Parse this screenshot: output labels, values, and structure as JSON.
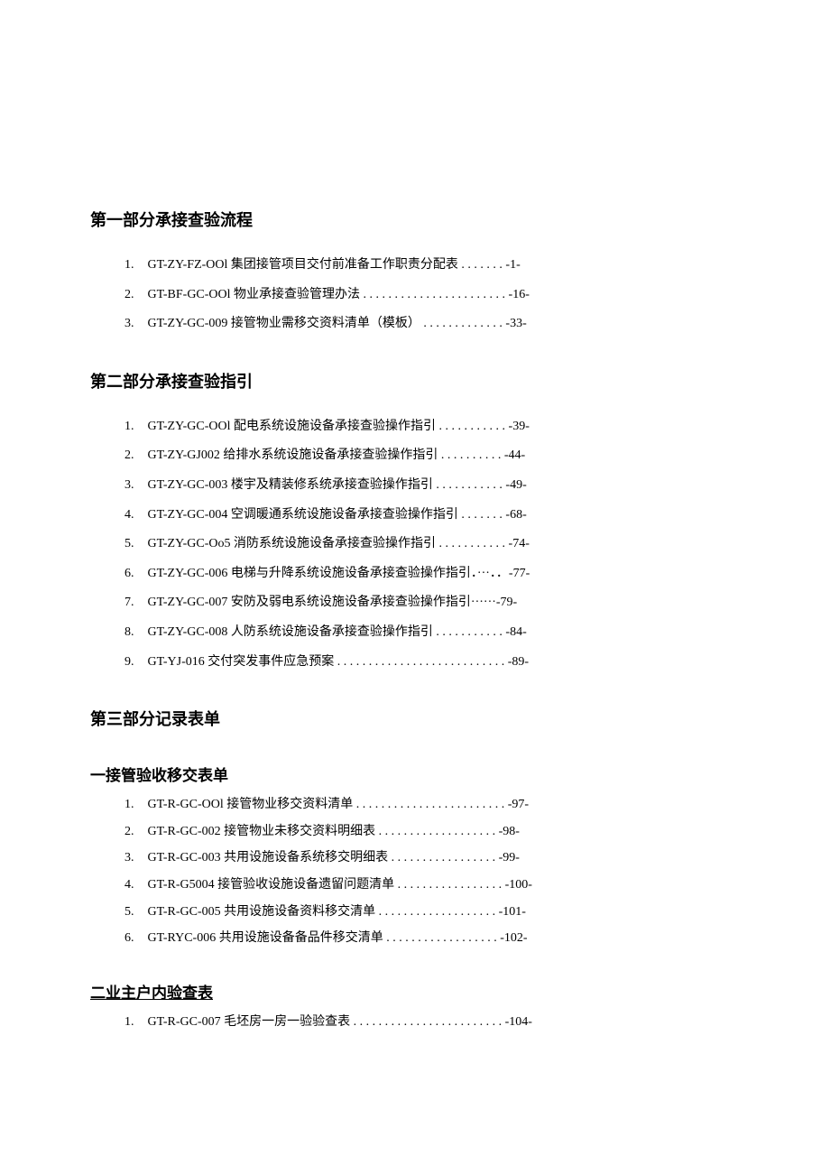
{
  "sections": [
    {
      "heading": "第一部分承接查验流程",
      "items": [
        {
          "num": "1.",
          "text": "GT-ZY-FZ-OOl 集团接管项目交付前准备工作职责分配表 . . . . . . . -1-"
        },
        {
          "num": "2.",
          "text": "GT-BF-GC-OOl 物业承接查验管理办法 . . . . . . . . . . . . . . . . . . . . . . . -16-"
        },
        {
          "num": "3.",
          "text": "GT-ZY-GC-009 接管物业需移交资料清单（模板） . . . . . . . . . . . . . -33-"
        }
      ]
    },
    {
      "heading": "第二部分承接查验指引",
      "items": [
        {
          "num": "1.",
          "text": "GT-ZY-GC-OOl 配电系统设施设备承接查验操作指引 . . . . . . . . . . . -39-"
        },
        {
          "num": "2.",
          "text": "GT-ZY-GJ002 给排水系统设施设备承接查验操作指引  . . . . . . . . . . -44-"
        },
        {
          "num": "3.",
          "text": "GT-ZY-GC-003 楼宇及精装修系统承接查验操作指引  . . . . . . . . . . . -49-"
        },
        {
          "num": "4.",
          "text": "GT-ZY-GC-004 空调暖通系统设施设备承接查验操作指引 . . . . . . . -68-"
        },
        {
          "num": "5.",
          "text": "GT-ZY-GC-Oo5 消防系统设施设备承接查验操作指引 . . . . . . . . . . . -74-"
        },
        {
          "num": "6.",
          "text": "GT-ZY-GC-006 电梯与升降系统设施设备承接查验操作指引．···．．-77-"
        },
        {
          "num": "7.",
          "text": "GT-ZY-GC-007 安防及弱电系统设施设备承接查验操作指引······-79-"
        },
        {
          "num": "8.",
          "text": "GT-ZY-GC-008 人防系统设施设备承接查验操作指引 . . . . . . . . . . . -84-"
        },
        {
          "num": "9.",
          "text": "GT-YJ-016 交付突发事件应急预案 . . . . . . . . . . . . . . . . . . . . . . . . . . . -89-"
        }
      ]
    },
    {
      "heading": "第三部分记录表单",
      "subsections": [
        {
          "subheading": "一接管验收移交表单",
          "underlined": false,
          "items": [
            {
              "num": "1.",
              "text": "GT-R-GC-OOl 接管物业移交资料清单 . . . . . . . . . . . . . . . . . . . . . . . . -97-"
            },
            {
              "num": "2.",
              "text": "GT-R-GC-002 接管物业未移交资料明细表  . . . . . . . . . . . . . . . . . . . -98-"
            },
            {
              "num": "3.",
              "text": "GT-R-GC-003 共用设施设备系统移交明细表 . . . . . . . . . . . . . . . . . -99-"
            },
            {
              "num": "4.",
              "text": "GT-R-G5004 接管验收设施设备遗留问题清单 . . . . . . . . . . . . . . . . . -100-"
            },
            {
              "num": "5.",
              "text": "GT-R-GC-005 共用设施设备资料移交清单  . . . . . . . . . . . . . . . . . . . -101-"
            },
            {
              "num": "6.",
              "text": "GT-RYC-006 共用设施设备备品件移交清单 . . . . . . . . . . . . . . . . . . -102-"
            }
          ]
        },
        {
          "subheading": "二业主户内验查表",
          "underlined": true,
          "items": [
            {
              "num": "1.",
              "text": "GT-R-GC-007 毛坯房一房一验验查表 . . . . . . . . . . . . . . . . . . . . . . . . -104-"
            }
          ]
        }
      ]
    }
  ]
}
